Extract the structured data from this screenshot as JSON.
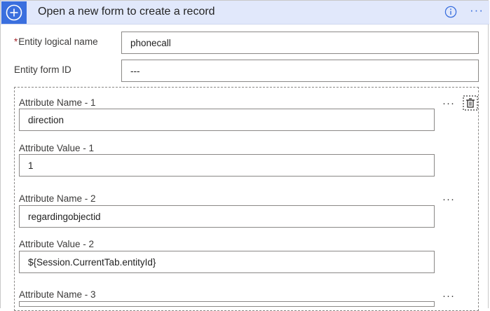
{
  "header": {
    "title": "Open a new form to create a record",
    "more_label": "···",
    "icons": [
      "plus-circle-icon",
      "info-icon"
    ]
  },
  "fields": {
    "entity_logical_name": {
      "required_mark": "*",
      "label": "Entity logical name",
      "value": "phonecall"
    },
    "entity_form_id": {
      "label": "Entity form ID",
      "value": "---"
    }
  },
  "attributes": [
    {
      "name_label": "Attribute Name - 1",
      "name_value": "direction",
      "value_label": "Attribute Value - 1",
      "value_value": "1"
    },
    {
      "name_label": "Attribute Name - 2",
      "name_value": "regardingobjectid",
      "value_label": "Attribute Value - 2",
      "value_value": "${Session.CurrentTab.entityId}"
    },
    {
      "name_label": "Attribute Name - 3"
    }
  ],
  "attribute_more_label": "···",
  "colors": {
    "header_bg": "#e1e8fb",
    "accent": "#3a6fde",
    "required": "#a4262c"
  }
}
